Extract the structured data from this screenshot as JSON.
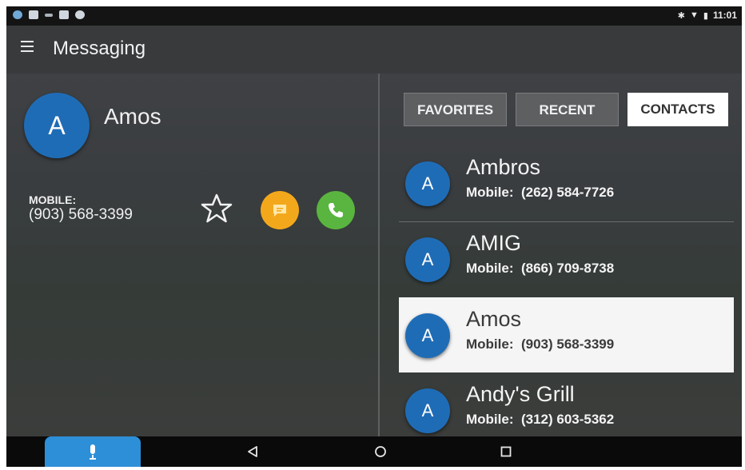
{
  "status_bar": {
    "time": "11:01",
    "icons": [
      "globe-icon",
      "image-icon",
      "signal-icon",
      "mail-icon",
      "android-icon",
      "bluetooth-icon",
      "wifi-icon",
      "battery-icon"
    ]
  },
  "toolbar": {
    "title": "Messaging",
    "menu_icon": "hamburger-menu-icon"
  },
  "detail": {
    "avatar_letter": "A",
    "name": "Amos",
    "mobile_label": "MOBILE:",
    "mobile_number": "(903) 568-3399",
    "actions": [
      "star-icon",
      "message-icon",
      "phone-icon"
    ],
    "colors": {
      "message": "#f3a81c",
      "call": "#59b53f",
      "avatar": "#1f6cb6"
    }
  },
  "tabs": [
    {
      "label": "FAVORITES",
      "active": false
    },
    {
      "label": "RECENT",
      "active": false
    },
    {
      "label": "CONTACTS",
      "active": true
    }
  ],
  "contacts": [
    {
      "letter": "A",
      "name": "Ambros",
      "label": "Mobile:",
      "phone": "(262) 584-7726",
      "selected": false
    },
    {
      "letter": "A",
      "name": "AMIG",
      "label": "Mobile:",
      "phone": "(866) 709-8738",
      "selected": false
    },
    {
      "letter": "A",
      "name": "Amos",
      "label": "Mobile:",
      "phone": "(903) 568-3399",
      "selected": true
    },
    {
      "letter": "A",
      "name": "Andy's Grill",
      "label": "Mobile:",
      "phone": "(312) 603-5362",
      "selected": false
    }
  ],
  "nav_bar": {
    "buttons": [
      "microphone-icon",
      "back-icon",
      "home-icon",
      "recents-icon"
    ],
    "accent": "#2d8fd8"
  }
}
